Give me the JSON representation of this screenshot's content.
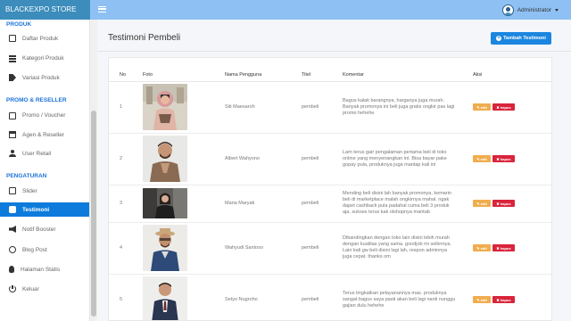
{
  "header": {
    "brand": "BLACKEXPO STORE",
    "user": "Administrator"
  },
  "sidebar": {
    "sections": [
      {
        "title": "PRODUK"
      },
      {
        "title": "PROMO & RESELLER"
      },
      {
        "title": "PENGATURAN"
      }
    ],
    "items": [
      {
        "label": "Daftar Produk",
        "icon": "document-icon"
      },
      {
        "label": "Kategori Produk",
        "icon": "list-icon"
      },
      {
        "label": "Variasi Produk",
        "icon": "tag-icon"
      },
      {
        "label": "Promo / Voucher",
        "icon": "card-icon"
      },
      {
        "label": "Agen & Reseller",
        "icon": "store-icon"
      },
      {
        "label": "User Retail",
        "icon": "user-icon"
      },
      {
        "label": "Slider",
        "icon": "slider-icon"
      },
      {
        "label": "Testimoni",
        "icon": "chat-icon",
        "active": true
      },
      {
        "label": "Notif Booster",
        "icon": "bullhorn-icon"
      },
      {
        "label": "Blog Post",
        "icon": "bubble-icon"
      },
      {
        "label": "Halaman Statis",
        "icon": "bulb-icon"
      },
      {
        "label": "Keluar",
        "icon": "power-icon"
      }
    ]
  },
  "main": {
    "title": "Testimoni Pembeli",
    "add_button": "Tambah Testimoni",
    "columns": [
      "No",
      "Foto",
      "Nama Pengguna",
      "Titel",
      "Komentar",
      "Aksi"
    ],
    "edit_label": "edit",
    "delete_label": "hapus",
    "rows": [
      {
        "no": "1",
        "name": "Siti Maesaroh",
        "title": "pembeli",
        "comment": "Bagus kalak barangnya, harganya juga murah. Banyak promonya ini beli juga gratis ongkir pas lagi promo hehehe"
      },
      {
        "no": "2",
        "name": "Albert Wahyono",
        "title": "pembeli",
        "comment": "Lam terus gair pengalaman pertama beli di toko online yang menyenangkan ini. Bisa bayar pake gopay pula, produknya juga mantap kali ini"
      },
      {
        "no": "3",
        "name": "Maria Maryati",
        "title": "pembeli",
        "comment": "Mending beli disini lah banyak promonya, kemarin beli di marketplace malah ongkirnya mahal. ngak dapet cashback pula padahal cuma beli 3 produk aja, sukses terus kak olshopnya mantab"
      },
      {
        "no": "4",
        "name": "Wahyudi Santoso",
        "title": "pembeli",
        "comment": "Dibandingkan dengan toko lain disini lebih murah dengan kualitas yang sama. goodjob mi sellernya. Lain kali gw beli disini lagi lah, respon adminnya juga cepat. thanks om"
      },
      {
        "no": "5",
        "name": "Setyo Nugroho",
        "title": "pembeli",
        "comment": "Terus tingkatkan pelayanannya mas. produknya sangat bagus saya pasti akan beli lagi nanti nunggu gajian dulu hehehe"
      }
    ]
  }
}
